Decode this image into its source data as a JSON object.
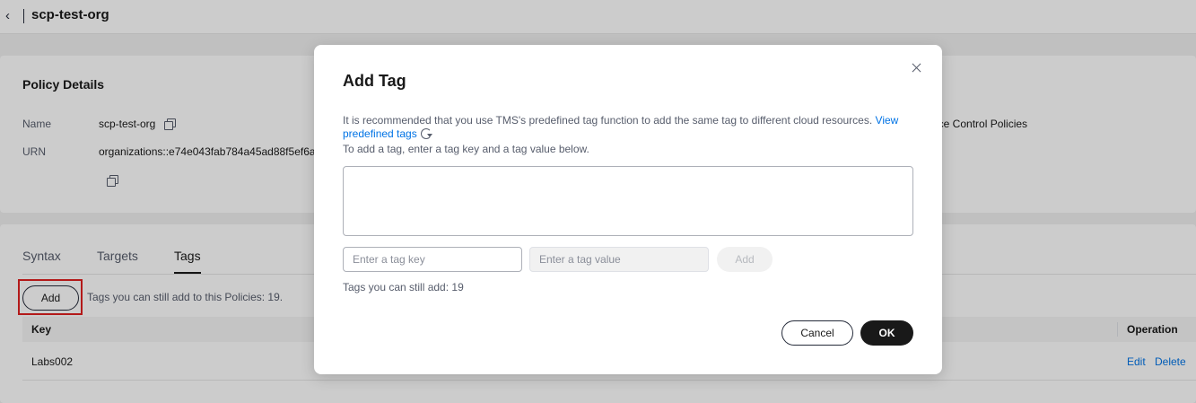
{
  "header": {
    "title": "scp-test-org",
    "back_icon": "chevron-left-icon"
  },
  "policy_details": {
    "title": "Policy Details",
    "name_label": "Name",
    "name_value": "scp-test-org",
    "urn_label": "URN",
    "urn_value": "organizations::e74e043fab784a45ad88f5ef6a",
    "type_fragment": "ice Control Policies"
  },
  "tabs": [
    {
      "label": "Syntax",
      "active": false
    },
    {
      "label": "Targets",
      "active": false
    },
    {
      "label": "Tags",
      "active": true
    }
  ],
  "tags_panel": {
    "add_label": "Add",
    "remaining_text": "Tags you can still add to this Policies: 19.",
    "columns": {
      "key": "Key",
      "operation": "Operation"
    },
    "rows": [
      {
        "key": "Labs002",
        "edit": "Edit",
        "delete": "Delete"
      }
    ]
  },
  "modal": {
    "title": "Add Tag",
    "description": "It is recommended that you use TMS's predefined tag function to add the same tag to different cloud resources.",
    "link_text": "View predefined tags",
    "instruction": "To add a tag, enter a tag key and a tag value below.",
    "key_placeholder": "Enter a tag key",
    "value_placeholder": "Enter a tag value",
    "add_label": "Add",
    "remaining": "Tags you can still add: 19",
    "cancel_label": "Cancel",
    "ok_label": "OK"
  },
  "colors": {
    "link": "#0073e5",
    "primary": "#191919",
    "highlight": "#e02020"
  }
}
